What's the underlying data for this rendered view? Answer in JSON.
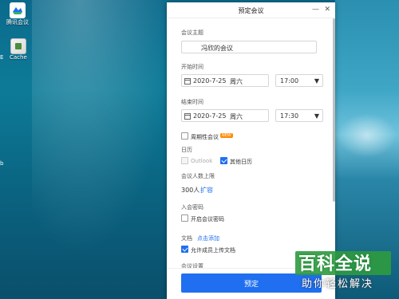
{
  "desktop": {
    "icons": [
      {
        "label": "腾讯会议",
        "icon": "tencent-meeting-icon"
      },
      {
        "label": "Cache",
        "icon": "file-icon"
      }
    ],
    "left_edge_chars": [
      "E",
      "b"
    ]
  },
  "dialog": {
    "title": "预定会议",
    "minimize": "—",
    "close": "✕",
    "subject": {
      "label": "会议主题",
      "value": "冯欣的会议"
    },
    "start": {
      "label": "开始时间",
      "date": "2020-7-25",
      "weekday": "周六",
      "time": "17:00"
    },
    "end": {
      "label": "结束时间",
      "date": "2020-7-25",
      "weekday": "周六",
      "time": "17:30"
    },
    "recurring": {
      "label": "周期性会议",
      "badge": "NEW",
      "checked": false
    },
    "calendar": {
      "label": "日历",
      "outlook": "Outlook",
      "outlook_checked": false,
      "other": "其他日历",
      "other_checked": true
    },
    "capacity": {
      "label": "会议人数上限",
      "value": "300人",
      "expand": "扩容"
    },
    "password": {
      "label": "入会密码",
      "toggle": "开启会议密码",
      "checked": false
    },
    "docs": {
      "label": "文档",
      "add": "点击添加",
      "allow": "允许成员上传文档",
      "checked": true
    },
    "settings_label": "会议设置",
    "submit": "预定"
  },
  "watermark": {
    "line1": "百科全说",
    "line2": "助你轻松解决"
  },
  "colors": {
    "accent": "#1f6ff0",
    "badge": "#ff8a00",
    "watermark_green": "#2e9b3f"
  }
}
